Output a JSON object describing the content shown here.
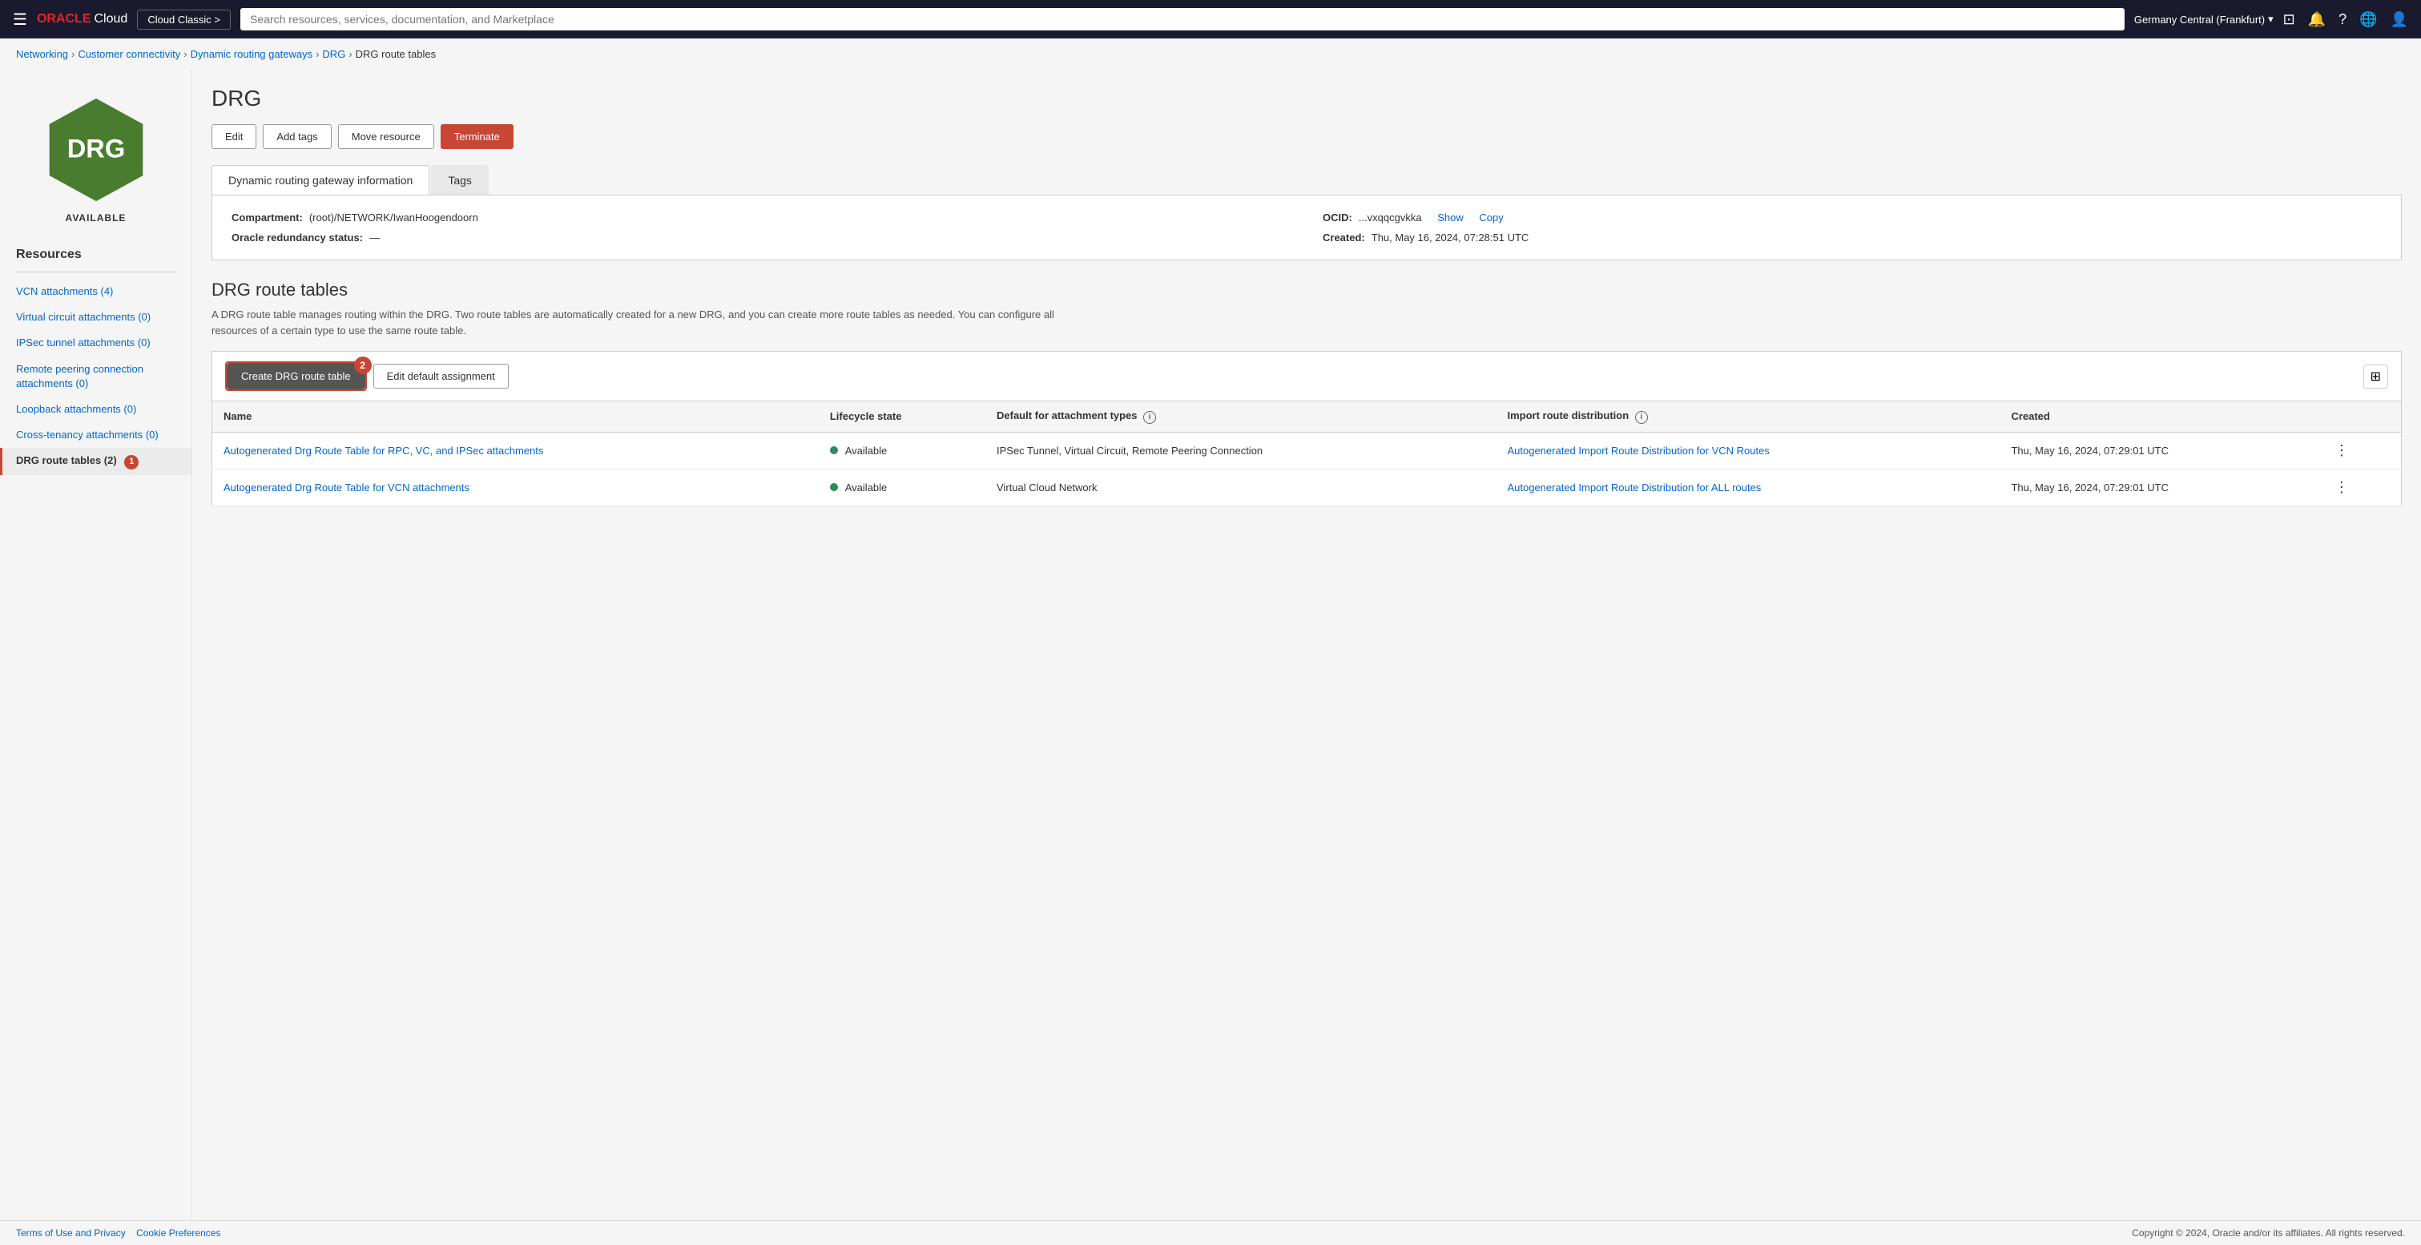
{
  "topnav": {
    "logo_oracle": "ORACLE",
    "logo_cloud": "Cloud",
    "classic_btn": "Cloud Classic >",
    "search_placeholder": "Search resources, services, documentation, and Marketplace",
    "region": "Germany Central (Frankfurt)",
    "region_chevron": "▾"
  },
  "breadcrumb": {
    "items": [
      {
        "label": "Networking",
        "href": "#"
      },
      {
        "label": "Customer connectivity",
        "href": "#"
      },
      {
        "label": "Dynamic routing gateways",
        "href": "#"
      },
      {
        "label": "DRG",
        "href": "#"
      },
      {
        "label": "DRG route tables",
        "href": null
      }
    ]
  },
  "sidebar": {
    "drg_label": "DRG",
    "status": "AVAILABLE",
    "resources_title": "Resources",
    "items": [
      {
        "label": "VCN attachments (4)",
        "active": false,
        "badge": null
      },
      {
        "label": "Virtual circuit attachments (0)",
        "active": false,
        "badge": null
      },
      {
        "label": "IPSec tunnel attachments (0)",
        "active": false,
        "badge": null
      },
      {
        "label": "Remote peering connection attachments (0)",
        "active": false,
        "badge": null
      },
      {
        "label": "Loopback attachments (0)",
        "active": false,
        "badge": null
      },
      {
        "label": "Cross-tenancy attachments (0)",
        "active": false,
        "badge": null
      },
      {
        "label": "DRG route tables (2)",
        "active": true,
        "badge": "1"
      }
    ]
  },
  "page": {
    "title": "DRG",
    "actions": {
      "edit": "Edit",
      "add_tags": "Add tags",
      "move_resource": "Move resource",
      "terminate": "Terminate"
    },
    "tabs": [
      {
        "label": "Dynamic routing gateway information",
        "active": true
      },
      {
        "label": "Tags",
        "active": false
      }
    ],
    "info": {
      "compartment_label": "Compartment:",
      "compartment_value": "(root)/NETWORK/IwanHoogendoorn",
      "ocid_label": "OCID:",
      "ocid_value": "...vxqqcgvkka",
      "ocid_show": "Show",
      "ocid_copy": "Copy",
      "redundancy_label": "Oracle redundancy status:",
      "redundancy_value": "—",
      "created_label": "Created:",
      "created_value": "Thu, May 16, 2024, 07:28:51 UTC"
    },
    "route_tables": {
      "title": "DRG route tables",
      "description": "A DRG route table manages routing within the DRG. Two route tables are automatically created for a new DRG, and you can create more route tables as needed. You can configure all resources of a certain type to use the same route table.",
      "create_btn": "Create DRG route table",
      "create_badge": "2",
      "edit_default_btn": "Edit default assignment",
      "table": {
        "columns": [
          {
            "label": "Name"
          },
          {
            "label": "Lifecycle state"
          },
          {
            "label": "Default for attachment types",
            "has_info": true
          },
          {
            "label": "Import route distribution",
            "has_info": true
          },
          {
            "label": "Created"
          }
        ],
        "rows": [
          {
            "name": "Autogenerated Drg Route Table for RPC, VC, and IPSec attachments",
            "name_href": "#",
            "lifecycle": "Available",
            "lifecycle_status": "green",
            "default_for": "IPSec Tunnel, Virtual Circuit, Remote Peering Connection",
            "import_route": "Autogenerated Import Route Distribution for VCN Routes",
            "import_route_href": "#",
            "created": "Thu, May 16, 2024, 07:29:01 UTC"
          },
          {
            "name": "Autogenerated Drg Route Table for VCN attachments",
            "name_href": "#",
            "lifecycle": "Available",
            "lifecycle_status": "green",
            "default_for": "Virtual Cloud Network",
            "import_route": "Autogenerated Import Route Distribution for ALL routes",
            "import_route_href": "#",
            "created": "Thu, May 16, 2024, 07:29:01 UTC"
          }
        ]
      }
    }
  },
  "footer": {
    "terms": "Terms of Use and Privacy",
    "cookie": "Cookie Preferences",
    "copyright": "Copyright © 2024, Oracle and/or its affiliates. All rights reserved."
  }
}
